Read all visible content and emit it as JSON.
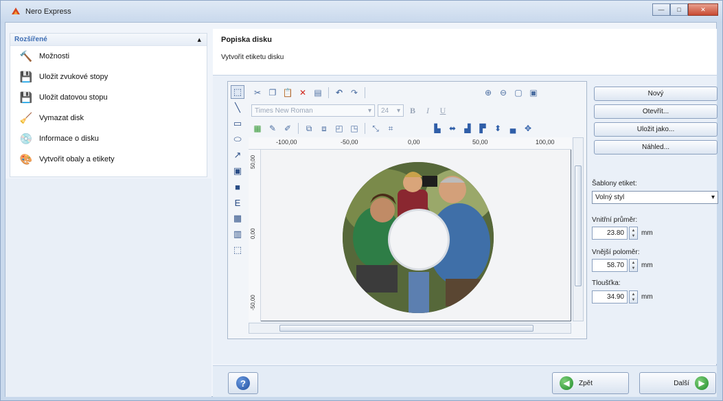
{
  "window": {
    "title": "Nero Express",
    "controls": {
      "minimize": "—",
      "maximize": "□",
      "close": "✕"
    }
  },
  "sidebar": {
    "header": "Rozšířené",
    "header_arrow": "▴",
    "items": [
      {
        "label": "Možnosti",
        "icon": "hammer-icon",
        "glyph": "🔨"
      },
      {
        "label": "Uložit zvukové stopy",
        "icon": "save-audio-icon",
        "glyph": "💾"
      },
      {
        "label": "Uložit datovou stopu",
        "icon": "save-data-icon",
        "glyph": "💾"
      },
      {
        "label": "Vymazat disk",
        "icon": "erase-disc-icon",
        "glyph": "🧹"
      },
      {
        "label": "Informace o disku",
        "icon": "disc-info-icon",
        "glyph": "💿"
      },
      {
        "label": "Vytvořit obaly a etikety",
        "icon": "cover-icon",
        "glyph": "🎨"
      }
    ]
  },
  "main": {
    "title": "Popiska disku",
    "subtitle": "Vytvořit etiketu disku"
  },
  "toolbar": {
    "font": "Times New Roman",
    "size": "24",
    "bold": "B",
    "italic": "I",
    "underline": "U"
  },
  "ruler": {
    "top_labels": [
      "-100,00",
      "-50,00",
      "0,00",
      "50,00",
      "100,00"
    ],
    "left_labels": [
      "50,00",
      "0,00",
      "-50,00"
    ]
  },
  "right_panel": {
    "buttons": {
      "new": "Nový",
      "open": "Otevřít...",
      "save_as": "Uložit jako...",
      "preview": "Náhled..."
    },
    "template_label": "Šablony etiket:",
    "template_value": "Volný styl",
    "inner_label": "Vnitřní průměr:",
    "inner_value": "23.80",
    "outer_label": "Vnější poloměr:",
    "outer_value": "58.70",
    "thickness_label": "Tloušťka:",
    "thickness_value": "34.90",
    "unit": "mm"
  },
  "bottom": {
    "help": "?",
    "back": "Zpět",
    "next": "Další"
  }
}
